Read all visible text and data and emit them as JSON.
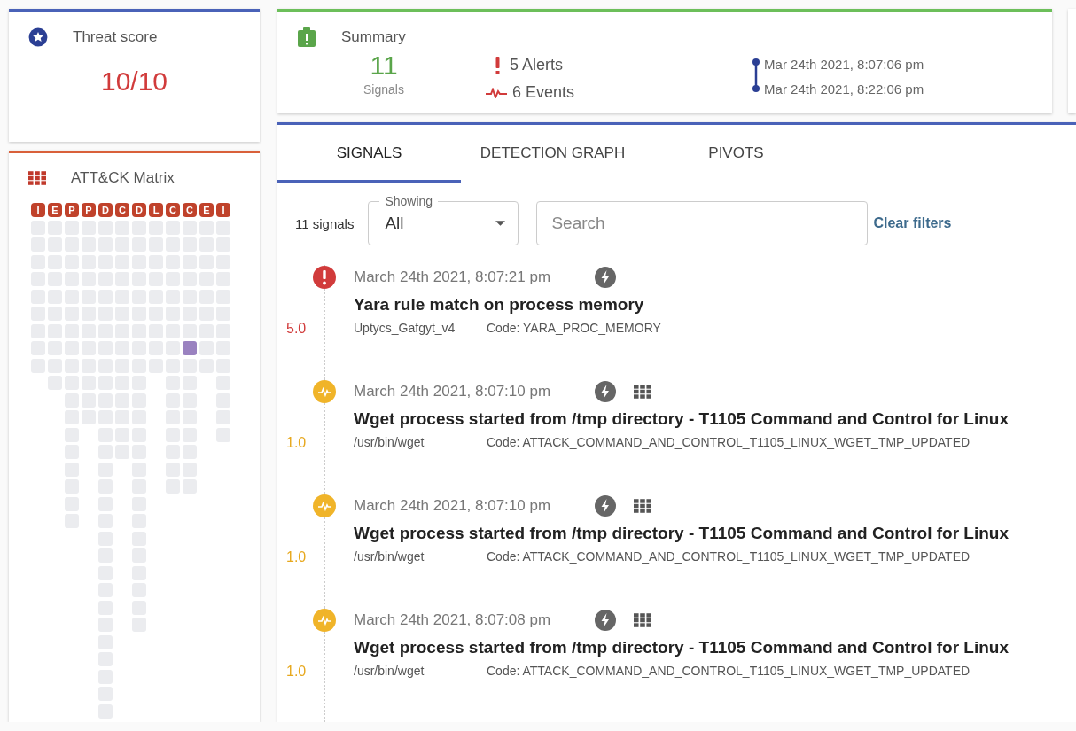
{
  "threat": {
    "title": "Threat score",
    "score": "10/10"
  },
  "summary": {
    "title": "Summary",
    "signals_count": "11",
    "signals_label": "Signals",
    "alerts": "5 Alerts",
    "events": "6 Events",
    "start": "Mar 24th 2021, 8:07:06 pm",
    "end": "Mar 24th 2021, 8:22:06 pm"
  },
  "matrix": {
    "title": "ATT&CK Matrix",
    "columns": [
      {
        "letter": "I",
        "cells": [
          false,
          false,
          false,
          false,
          false,
          false,
          false,
          false,
          false
        ]
      },
      {
        "letter": "E",
        "cells": [
          false,
          false,
          false,
          false,
          false,
          false,
          false,
          false,
          false,
          false
        ]
      },
      {
        "letter": "P",
        "cells": [
          false,
          false,
          false,
          false,
          false,
          false,
          false,
          false,
          false,
          false,
          false,
          false,
          false,
          false,
          false,
          false,
          false,
          false
        ]
      },
      {
        "letter": "P",
        "cells": [
          false,
          false,
          false,
          false,
          false,
          false,
          false,
          false,
          false,
          false,
          false,
          false
        ]
      },
      {
        "letter": "D",
        "cells": [
          false,
          false,
          false,
          false,
          false,
          false,
          false,
          false,
          false,
          false,
          false,
          false,
          false,
          false,
          false,
          false,
          false,
          false,
          false,
          false,
          false,
          false,
          false,
          false,
          false,
          false,
          false,
          false,
          false
        ]
      },
      {
        "letter": "C",
        "cells": [
          false,
          false,
          false,
          false,
          false,
          false,
          false,
          false,
          false,
          false,
          false,
          false,
          false,
          false
        ]
      },
      {
        "letter": "D",
        "cells": [
          false,
          false,
          false,
          false,
          false,
          false,
          false,
          false,
          false,
          false,
          false,
          false,
          false,
          false,
          false,
          false,
          false,
          false,
          false,
          false,
          false,
          false,
          false,
          false
        ]
      },
      {
        "letter": "L",
        "cells": [
          false,
          false,
          false,
          false,
          false,
          false,
          false,
          false,
          false
        ]
      },
      {
        "letter": "C",
        "cells": [
          false,
          false,
          false,
          false,
          false,
          false,
          false,
          false,
          false,
          false,
          false,
          false,
          false,
          false,
          false,
          false
        ]
      },
      {
        "letter": "C",
        "cells": [
          false,
          false,
          false,
          false,
          false,
          false,
          false,
          true,
          false,
          false,
          false,
          false,
          false,
          false,
          false,
          false
        ]
      },
      {
        "letter": "E",
        "cells": [
          false,
          false,
          false,
          false,
          false,
          false,
          false,
          false,
          false
        ]
      },
      {
        "letter": "I",
        "cells": [
          false,
          false,
          false,
          false,
          false,
          false,
          false,
          false,
          false,
          false,
          false,
          false,
          false
        ]
      }
    ]
  },
  "tabs": [
    {
      "label": "SIGNALS",
      "selected": true
    },
    {
      "label": "DETECTION GRAPH",
      "selected": false
    },
    {
      "label": "PIVOTS",
      "selected": false
    }
  ],
  "filters": {
    "count": "11 signals",
    "showing_label": "Showing",
    "showing_value": "All",
    "search_placeholder": "Search",
    "clear": "Clear filters"
  },
  "signals": [
    {
      "kind": "alert",
      "time": "March 24th 2021, 8:07:21 pm",
      "matrix": false,
      "title": "Yara rule match on process memory",
      "source": "Uptycs_Gafgyt_v4",
      "code": "Code: YARA_PROC_MEMORY",
      "score": "5.0"
    },
    {
      "kind": "event",
      "time": "March 24th 2021, 8:07:10 pm",
      "matrix": true,
      "title": "Wget process started from /tmp directory - T1105 Command and Control for Linux",
      "source": "/usr/bin/wget",
      "code": "Code: ATTACK_COMMAND_AND_CONTROL_T1105_LINUX_WGET_TMP_UPDATED",
      "score": "1.0"
    },
    {
      "kind": "event",
      "time": "March 24th 2021, 8:07:10 pm",
      "matrix": true,
      "title": "Wget process started from /tmp directory - T1105 Command and Control for Linux",
      "source": "/usr/bin/wget",
      "code": "Code: ATTACK_COMMAND_AND_CONTROL_T1105_LINUX_WGET_TMP_UPDATED",
      "score": "1.0"
    },
    {
      "kind": "event",
      "time": "March 24th 2021, 8:07:08 pm",
      "matrix": true,
      "title": "Wget process started from /tmp directory - T1105 Command and Control for Linux",
      "source": "/usr/bin/wget",
      "code": "Code: ATTACK_COMMAND_AND_CONTROL_T1105_LINUX_WGET_TMP_UPDATED",
      "score": "1.0"
    }
  ]
}
